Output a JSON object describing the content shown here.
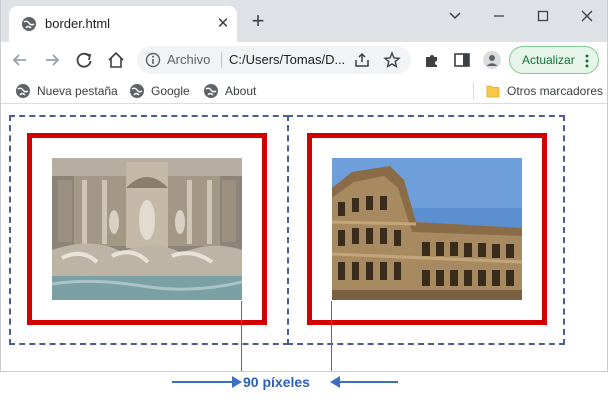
{
  "browser": {
    "tab": {
      "title": "border.html"
    },
    "new_tab_symbol": "+",
    "omnibox": {
      "scheme_label": "Archivo",
      "url": "C:/Users/Tomas/D..."
    },
    "update_button": {
      "label": "Actualizar"
    }
  },
  "bookmarks": {
    "items": [
      {
        "label": "Nueva pestaña",
        "icon": "globe-icon"
      },
      {
        "label": "Google",
        "icon": "globe-icon"
      },
      {
        "label": "About",
        "icon": "globe-icon"
      }
    ],
    "other": {
      "label": "Otros marcadores",
      "icon": "folder-icon"
    }
  },
  "page": {
    "images": [
      {
        "subject": "Fontana di Trevi"
      },
      {
        "subject": "Colosseum"
      }
    ],
    "colors": {
      "border_red": "#d40000",
      "dashed_outline": "#4c5c96",
      "annotation_blue": "#2f5fb0"
    }
  },
  "annotation": {
    "label": "90 píxeles"
  }
}
